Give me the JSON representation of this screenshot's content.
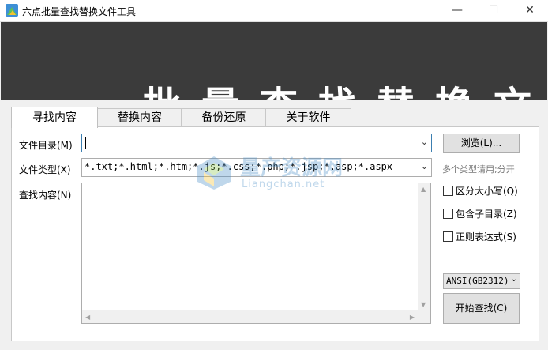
{
  "window": {
    "title": "六点批量查找替换文件工具",
    "minimize_glyph": "—",
    "maximize_glyph": "☐",
    "close_glyph": "✕"
  },
  "banner": {
    "text": "批量查找替换文件工具"
  },
  "tabs": [
    {
      "label": "寻找内容",
      "active": true
    },
    {
      "label": "替换内容",
      "active": false
    },
    {
      "label": "备份还原",
      "active": false
    },
    {
      "label": "关于软件",
      "active": false
    }
  ],
  "form": {
    "dir_label": "文件目录(M)",
    "dir_value": "",
    "type_label": "文件类型(X)",
    "type_value": "*.txt;*.html;*.htm;*.js;*.css;*.php;*.jsp;*.asp;*.aspx",
    "find_label": "查找内容(N)",
    "find_value": "",
    "browse_label": "浏览(L)...",
    "type_hint": "多个类型请用;分开"
  },
  "options": {
    "case_sensitive": "区分大小写(Q)",
    "include_subdirs": "包含子目录(Z)",
    "regex": "正则表达式(S)"
  },
  "encoding": {
    "selected": "ANSI(GB2312)"
  },
  "actions": {
    "start_label": "开始查找(C)"
  },
  "watermark": {
    "cn": "量产资源网",
    "en": "Liangchan.net"
  },
  "icons": {
    "app": "app-logo-icon",
    "dropdown": "chevron-down-icon"
  },
  "colors": {
    "banner_bg": "#3b3b3b",
    "focus_border": "#3c7fb1",
    "watermark": "#4a90c8"
  }
}
